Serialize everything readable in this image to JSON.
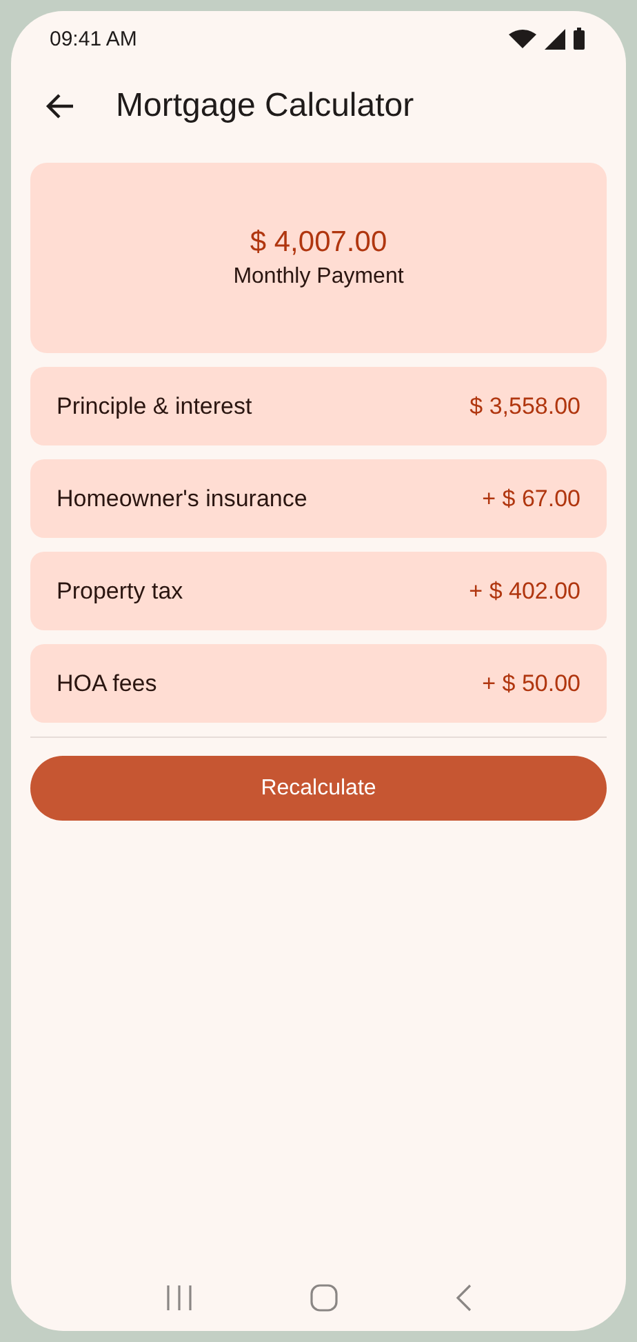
{
  "status_bar": {
    "time": "09:41 AM"
  },
  "app_bar": {
    "title": "Mortgage Calculator"
  },
  "summary": {
    "amount": "$ 4,007.00",
    "label": "Monthly Payment"
  },
  "costs": [
    {
      "label": "Principle & interest",
      "amount": "$ 3,558.00"
    },
    {
      "label": "Homeowner's insurance",
      "amount": "+ $ 67.00"
    },
    {
      "label": "Property tax",
      "amount": "+ $ 402.00"
    },
    {
      "label": "HOA fees",
      "amount": "+ $ 50.00"
    }
  ],
  "action": {
    "label": "Recalculate"
  }
}
